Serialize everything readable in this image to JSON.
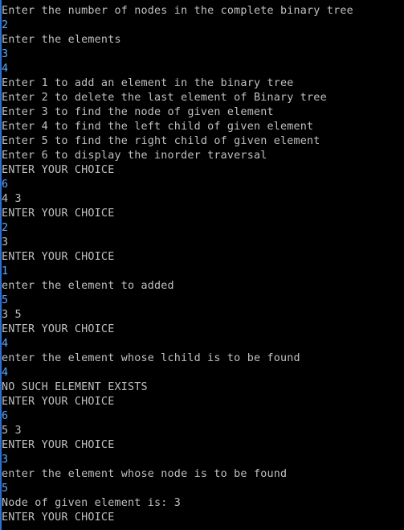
{
  "console": {
    "text_color": "#c0c0c0",
    "input_color": "#5fa8ff",
    "background": "#000000",
    "lines": [
      {
        "text": "Enter the number of nodes in the complete binary tree",
        "kind": "output"
      },
      {
        "text": "2",
        "kind": "input"
      },
      {
        "text": "Enter the elements",
        "kind": "output"
      },
      {
        "text": "3",
        "kind": "input"
      },
      {
        "text": "4",
        "kind": "input"
      },
      {
        "text": "Enter 1 to add an element in the binary tree",
        "kind": "output"
      },
      {
        "text": "Enter 2 to delete the last element of Binary tree",
        "kind": "output"
      },
      {
        "text": "Enter 3 to find the node of given element",
        "kind": "output"
      },
      {
        "text": "Enter 4 to find the left child of given element",
        "kind": "output"
      },
      {
        "text": "Enter 5 to find the right child of given element",
        "kind": "output"
      },
      {
        "text": "Enter 6 to display the inorder traversal",
        "kind": "output"
      },
      {
        "text": "ENTER YOUR CHOICE",
        "kind": "output"
      },
      {
        "text": "6",
        "kind": "input"
      },
      {
        "text": "4 3",
        "kind": "output"
      },
      {
        "text": "ENTER YOUR CHOICE",
        "kind": "output"
      },
      {
        "text": "2",
        "kind": "input"
      },
      {
        "text": "3",
        "kind": "output"
      },
      {
        "text": "ENTER YOUR CHOICE",
        "kind": "output"
      },
      {
        "text": "1",
        "kind": "input"
      },
      {
        "text": "enter the element to added",
        "kind": "output"
      },
      {
        "text": "5",
        "kind": "input"
      },
      {
        "text": "3 5",
        "kind": "output"
      },
      {
        "text": "ENTER YOUR CHOICE",
        "kind": "output"
      },
      {
        "text": "4",
        "kind": "input"
      },
      {
        "text": "enter the element whose lchild is to be found",
        "kind": "output"
      },
      {
        "text": "4",
        "kind": "input"
      },
      {
        "text": "NO SUCH ELEMENT EXISTS",
        "kind": "output"
      },
      {
        "text": "ENTER YOUR CHOICE",
        "kind": "output"
      },
      {
        "text": "6",
        "kind": "input"
      },
      {
        "text": "5 3",
        "kind": "output"
      },
      {
        "text": "ENTER YOUR CHOICE",
        "kind": "output"
      },
      {
        "text": "3",
        "kind": "input"
      },
      {
        "text": "enter the element whose node is to be found",
        "kind": "output"
      },
      {
        "text": "5",
        "kind": "input"
      },
      {
        "text": "Node of given element is: 3",
        "kind": "output"
      },
      {
        "text": "ENTER YOUR CHOICE",
        "kind": "output"
      }
    ]
  }
}
